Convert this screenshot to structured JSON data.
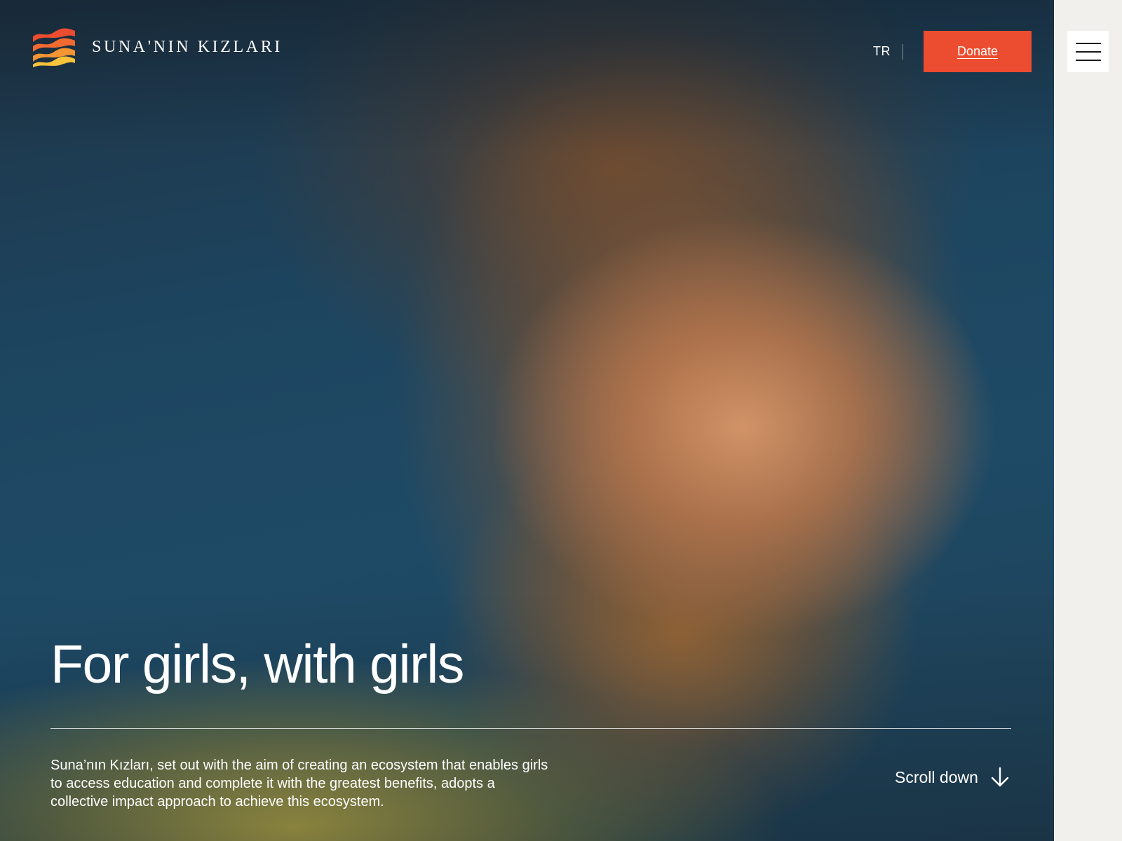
{
  "header": {
    "brand_name": "SUNA'NIN KIZLARI",
    "logo_icon": "wave-stripes-logo",
    "language_link": "TR",
    "donate_label": "Donate",
    "menu_icon": "hamburger-menu-icon"
  },
  "hero": {
    "headline": "For girls, with girls",
    "intro": "Suna’nın Kızları, set out with the aim of creating an ecosystem that enables girls to access education and complete it with the greatest benefits, adopts a collective impact approach to achieve this ecosystem.",
    "scroll_label": "Scroll down",
    "scroll_icon": "arrow-down-icon"
  },
  "colors": {
    "accent": "#ec4c2f",
    "logo_stripes": [
      "#ec4c2f",
      "#f59432",
      "#f8c23a"
    ],
    "side_panel": "#f1f0ec"
  }
}
